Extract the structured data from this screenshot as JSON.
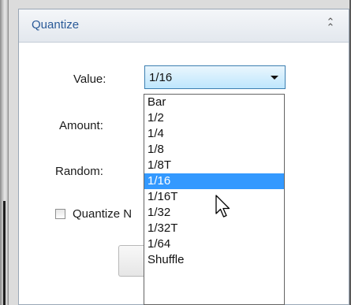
{
  "panel": {
    "title": "Quantize",
    "collapse_icon": "double-chevron-up-icon"
  },
  "fields": {
    "value_label": "Value:",
    "amount_label": "Amount:",
    "random_label": "Random:",
    "quantize_checkbox_label": "Quantize N"
  },
  "value_select": {
    "selected": "1/16",
    "options": [
      "Bar",
      "1/2",
      "1/4",
      "1/8",
      "1/8T",
      "1/16",
      "1/16T",
      "1/32",
      "1/32T",
      "1/64",
      "Shuffle"
    ],
    "highlighted": "1/16"
  },
  "colors": {
    "title": "#2a5a98",
    "highlight": "#3399ff",
    "select_border": "#3c7fb1"
  },
  "checkbox_checked": false
}
